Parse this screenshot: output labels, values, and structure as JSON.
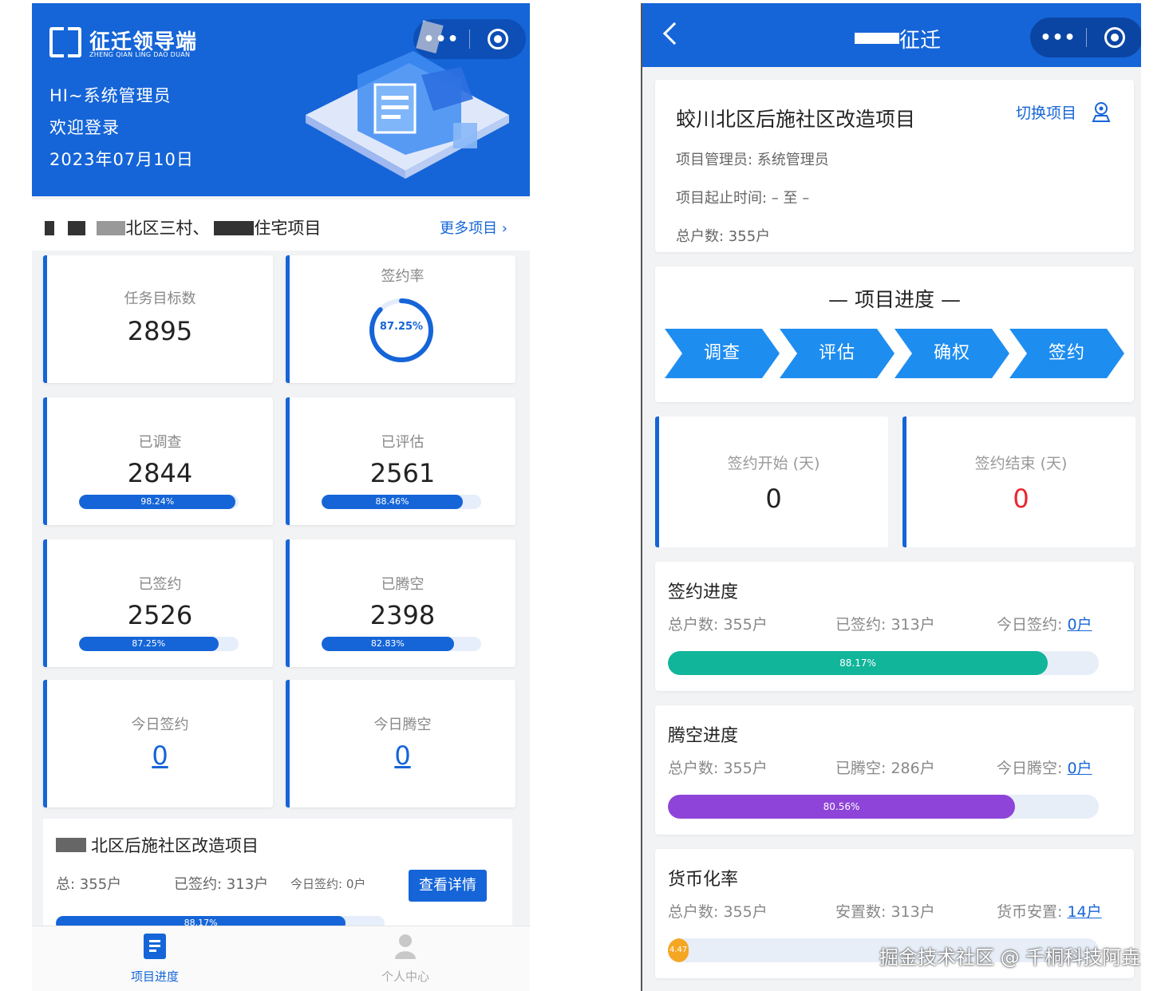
{
  "left": {
    "app_title": "征迁领导端",
    "app_subtitle": "ZHENG QIAN LING DAO DUAN",
    "greeting": "HI~系统管理员",
    "welcome": "欢迎登录",
    "date": "2023年07月10日",
    "header_more_icon": "more-dots-icon",
    "header_target_icon": "target-icon",
    "project_name": "北区三村、",
    "project_name_suffix": "住宅项目",
    "more_projects": "更多项目 ›",
    "cards": [
      {
        "label": "任务目标数",
        "value": "2895"
      },
      {
        "label": "签约率",
        "ring_text": "87.25%",
        "ring_fraction": 0.8725
      },
      {
        "label": "已调查",
        "value": "2844",
        "progress_text": "98.24%",
        "progress": 0.9824
      },
      {
        "label": "已评估",
        "value": "2561",
        "progress_text": "88.46%",
        "progress": 0.8846
      },
      {
        "label": "已签约",
        "value": "2526",
        "progress_text": "87.25%",
        "progress": 0.8725
      },
      {
        "label": "已腾空",
        "value": "2398",
        "progress_text": "82.83%",
        "progress": 0.8283
      },
      {
        "label": "今日签约",
        "value": "0"
      },
      {
        "label": "今日腾空",
        "value": "0"
      }
    ],
    "bottom_card": {
      "title": "北区后施社区改造项目",
      "total": "总:  355户",
      "signed": "已签约: 313户",
      "today": "今日签约: 0户",
      "button": "查看详情",
      "progress_text": "88.17%",
      "progress": 0.8817
    },
    "tabs": [
      {
        "label": "项目进度",
        "icon": "document-icon",
        "active": true
      },
      {
        "label": "个人中心",
        "icon": "user-icon",
        "active": false
      }
    ],
    "colors": {
      "primary": "#1565d8"
    }
  },
  "right": {
    "title": "征迁",
    "project_title": "蛟川北区后施社区改造项目",
    "switch_label": "切换项目",
    "manager": "项目管理员:  系统管理员",
    "period": "项目起止时间:  –  至  –",
    "households": "总户数:   355户",
    "progress_title": "—  项目进度  —",
    "steps": [
      "调查",
      "评估",
      "确权",
      "签约"
    ],
    "sign_start_label": "签约开始 (天)",
    "sign_start_value": "0",
    "sign_end_label": "签约结束 (天)",
    "sign_end_value": "0",
    "sections": [
      {
        "title": "签约进度",
        "stat1": "总户数:  355户",
        "stat2": "已签约:  313户",
        "stat3_label": "今日签约:",
        "stat3_value": "0户",
        "progress_text": "88.17%",
        "progress": 0.8817,
        "color": "#11b59a"
      },
      {
        "title": "腾空进度",
        "stat1": "总户数:  355户",
        "stat2": "已腾空:  286户",
        "stat3_label": "今日腾空:",
        "stat3_value": "0户",
        "progress_text": "80.56%",
        "progress": 0.8056,
        "color": "#8e44d8"
      },
      {
        "title": "货币化率",
        "stat1": "总户数:  355户",
        "stat2": "安置数:  313户",
        "stat3_label": "货币安置:",
        "stat3_value": "14户",
        "progress_text": "4.47",
        "progress": 0.0447,
        "color": "#f5a623"
      }
    ],
    "watermark": "掘金技术社区 @ 千桐科技阿垚"
  }
}
